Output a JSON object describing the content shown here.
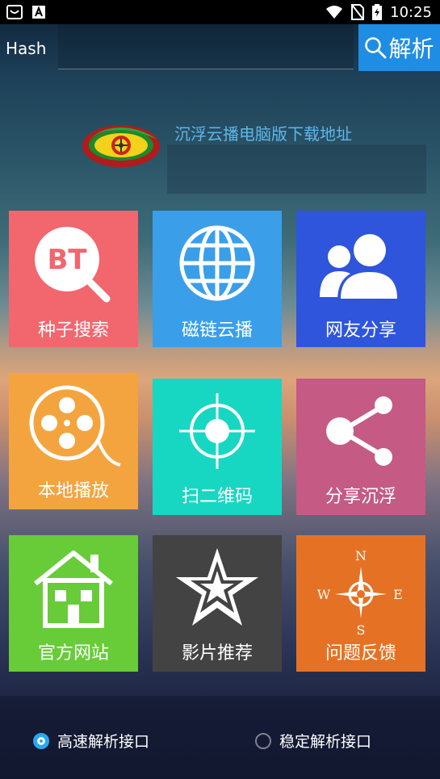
{
  "status_bar": {
    "time": "10:25",
    "icons": [
      "notification-icon",
      "a-icon",
      "wifi-icon",
      "no-sim-icon",
      "battery-icon"
    ]
  },
  "search": {
    "label": "Hash",
    "value": "",
    "placeholder": "",
    "button_label": "解析"
  },
  "banner": {
    "link_text": "沉浮云播电脑版下载地址"
  },
  "tiles": [
    {
      "label": "种子搜索",
      "icon": "bt-search-icon",
      "color": "#f2666e"
    },
    {
      "label": "磁链云播",
      "icon": "globe-icon",
      "color": "#3b9ee9"
    },
    {
      "label": "网友分享",
      "icon": "users-icon",
      "color": "#2f55dc"
    },
    {
      "label": "本地播放",
      "icon": "film-reel-icon",
      "color": "#f4a43f"
    },
    {
      "label": "扫二维码",
      "icon": "crosshair-icon",
      "color": "#18d7c2"
    },
    {
      "label": "分享沉浮",
      "icon": "share-icon",
      "color": "#c55a84"
    },
    {
      "label": "官方网站",
      "icon": "home-icon",
      "color": "#67cc37"
    },
    {
      "label": "影片推荐",
      "icon": "star-icon",
      "color": "#434343"
    },
    {
      "label": "问题反馈",
      "icon": "compass-icon",
      "color": "#e57224"
    }
  ],
  "compass_labels": {
    "n": "N",
    "s": "S",
    "e": "E",
    "w": "W"
  },
  "bt_text": "BT",
  "interfaces": {
    "options": [
      "高速解析接口",
      "稳定解析接口"
    ],
    "selected": "高速解析接口"
  },
  "colors": {
    "accent": "#1f8de3",
    "radio_selected": "#2aa7ef",
    "link": "#5fb6ea"
  }
}
